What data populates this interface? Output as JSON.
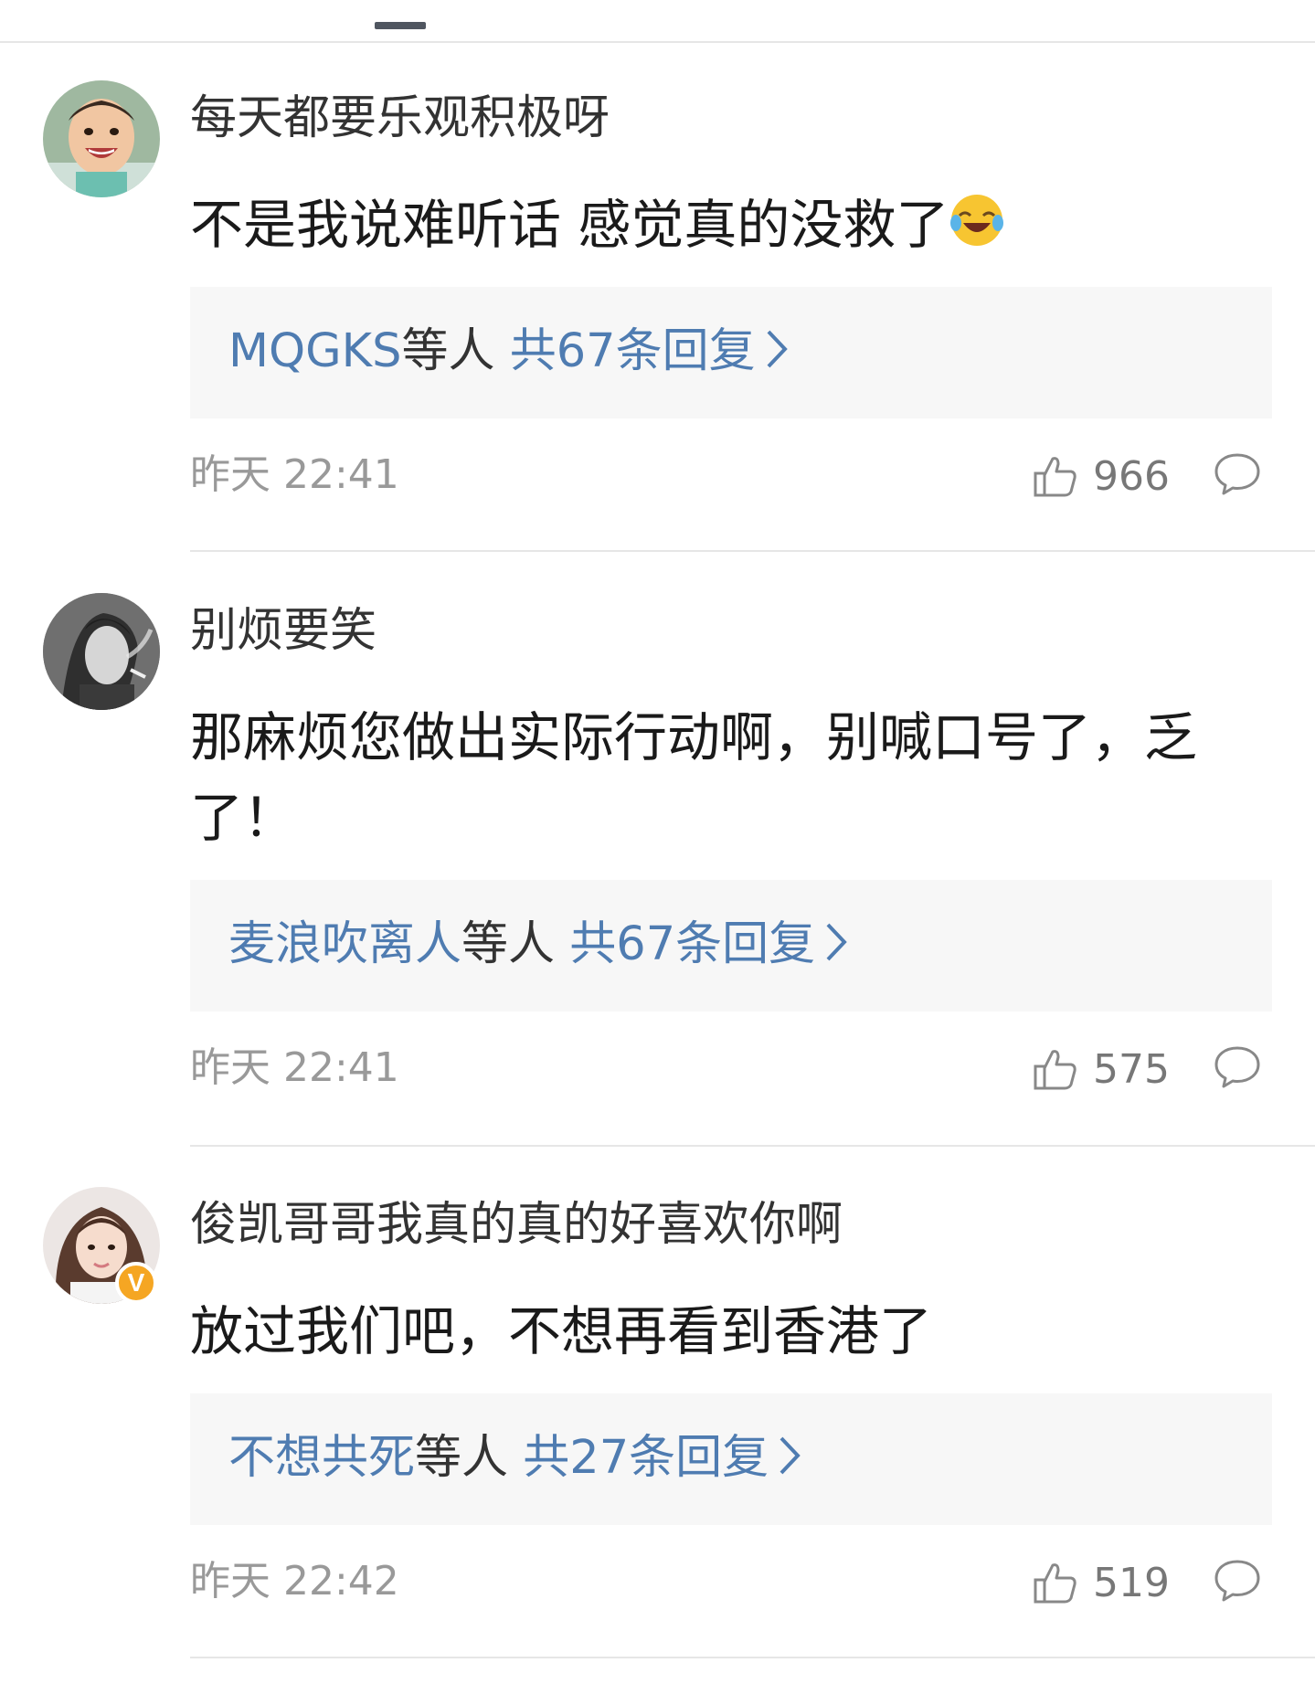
{
  "comments": [
    {
      "username": "每天都要乐观积极呀",
      "content": "不是我说难听话 感觉真的没救了",
      "emoji": "laughing-crying-emoji",
      "replies": {
        "who": "MQGKS",
        "sep": "等人",
        "count": "共67条回复"
      },
      "time": "昨天 22:41",
      "likes": "966",
      "verified": false
    },
    {
      "username": "别烦要笑",
      "content": "那麻烦您做出实际行动啊，别喊口号了，乏了！",
      "replies": {
        "who": "麦浪吹离人",
        "sep": "等人",
        "count": "共67条回复"
      },
      "time": "昨天 22:41",
      "likes": "575",
      "verified": false
    },
    {
      "username": "俊凯哥哥我真的真的好喜欢你啊",
      "content": "放过我们吧，不想再看到香港了",
      "replies": {
        "who": "不想共死",
        "sep": "等人",
        "count": "共27条回复"
      },
      "time": "昨天 22:42",
      "likes": "519",
      "verified": true,
      "badge": "V"
    }
  ],
  "colors": {
    "link": "#4f7cb1",
    "meta": "#999999",
    "reply_bg": "#f7f7f7",
    "badge": "#f5a623"
  },
  "icons": {
    "like": "thumbs-up-icon",
    "comment": "comment-bubble-icon",
    "chevron": "chevron-right-icon"
  }
}
